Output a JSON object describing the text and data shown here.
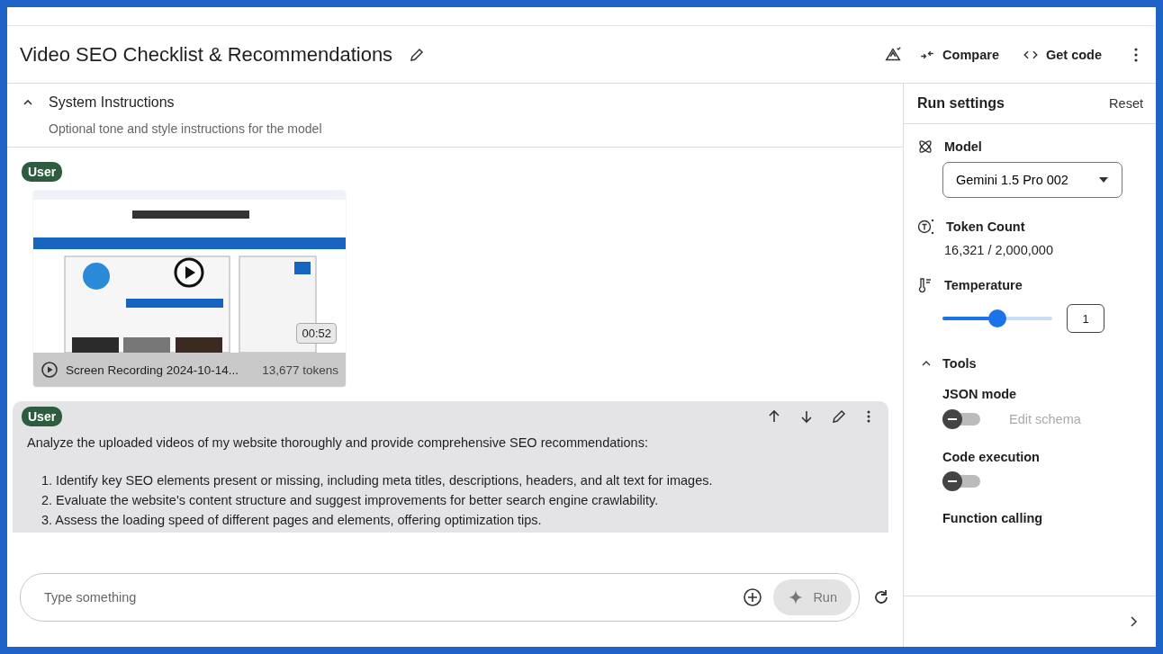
{
  "header": {
    "title": "Video SEO Checklist & Recommendations",
    "actions": [
      {
        "kind": "compare",
        "label": "Compare"
      },
      {
        "kind": "code",
        "label": "Get code"
      }
    ]
  },
  "system_instructions": {
    "title": "System Instructions",
    "expanded": true,
    "placeholder": "Optional tone and style instructions for the model"
  },
  "turns": [
    {
      "role": "User",
      "kind": "video",
      "duration": "00:52",
      "name": "Screen Recording 2024-10-14...",
      "tokens": "13,677 tokens"
    },
    {
      "role": "User",
      "kind": "text",
      "intro": "Analyze the uploaded videos of my website thoroughly and provide comprehensive SEO recommendations:",
      "items": [
        "1. Identify key SEO elements present or missing, including meta titles, descriptions, headers, and alt text for images.",
        "2. Evaluate the website's content structure and suggest improvements for better search engine crawlability.",
        "3. Assess the loading speed of different pages and elements, offering optimization tips."
      ]
    }
  ],
  "prompt": {
    "placeholder": "Type something",
    "run_label": "Run",
    "run_disabled": true
  },
  "run_settings": {
    "title": "Run settings",
    "reset": "Reset",
    "model_label": "Model",
    "model": "Gemini 1.5 Pro 002",
    "token_label": "Token Count",
    "token_count": "16,321 / 2,000,000",
    "temperature_label": "Temperature",
    "temperature": {
      "level": 0.5,
      "value": "1"
    },
    "tools": {
      "title": "Tools",
      "expanded": true,
      "items": [
        {
          "kind": "toggle",
          "label": "JSON mode",
          "on": false,
          "link": "Edit schema",
          "link_disabled": true
        },
        {
          "kind": "toggle",
          "label": "Code execution",
          "on": false
        },
        {
          "kind": "label",
          "label": "Function calling"
        }
      ]
    }
  }
}
